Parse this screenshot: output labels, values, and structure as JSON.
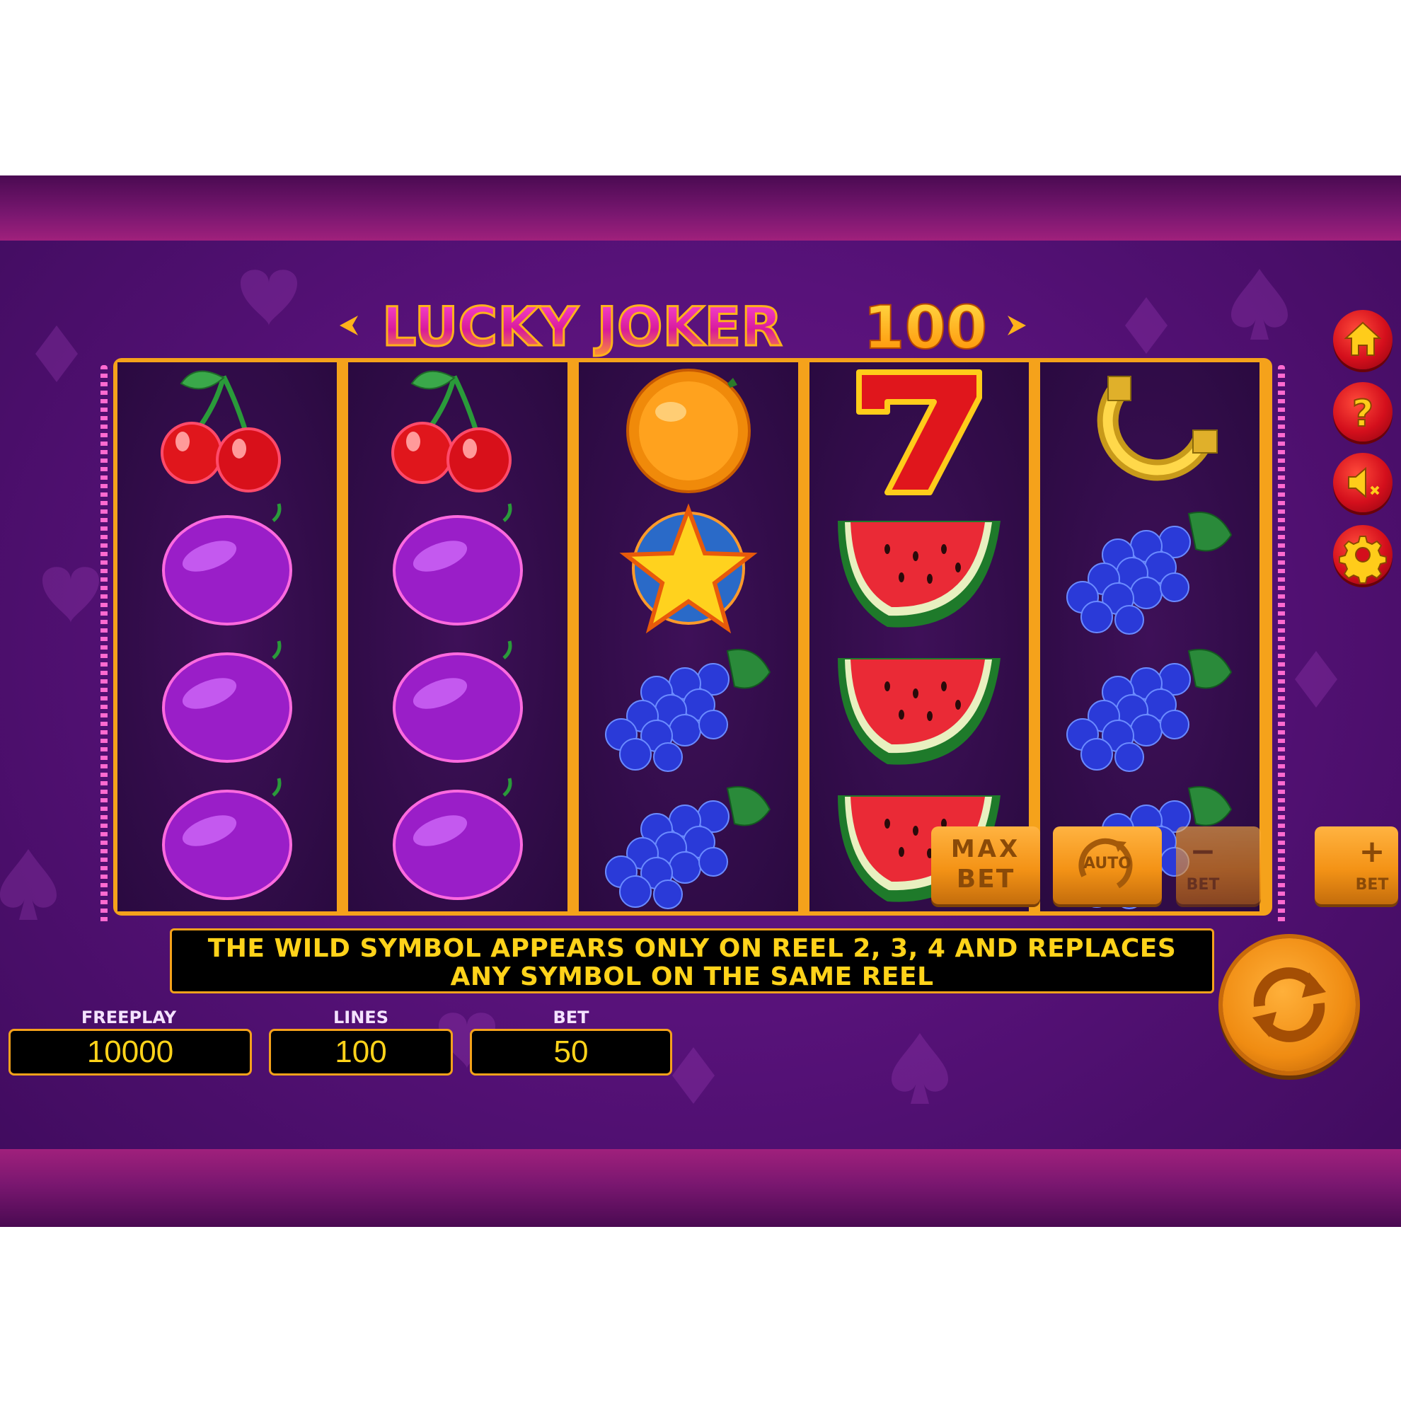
{
  "game": {
    "title_part1": "LUCKY JOKER",
    "title_part2": "100"
  },
  "reels": [
    [
      "cherry",
      "plum",
      "plum",
      "plum"
    ],
    [
      "cherry",
      "plum",
      "plum",
      "plum"
    ],
    [
      "orange",
      "star",
      "grapes",
      "grapes"
    ],
    [
      "seven",
      "watermelon",
      "watermelon",
      "watermelon"
    ],
    [
      "horseshoe",
      "grapes",
      "grapes",
      "grapes"
    ]
  ],
  "info_message": {
    "line1": "THE WILD SYMBOL APPEARS ONLY ON REEL 2, 3, 4 AND REPLACES",
    "line2": "ANY SYMBOL ON THE SAME REEL"
  },
  "stats": {
    "freeplay_label": "FREEPLAY",
    "freeplay_value": "10000",
    "lines_label": "LINES",
    "lines_value": "100",
    "bet_label": "BET",
    "bet_value": "50"
  },
  "controls": {
    "max_label": "MAX",
    "max_bet_label": "BET",
    "auto_label": "AUTO",
    "bet_minus_symbol": "−",
    "bet_minus_label": "BET",
    "bet_plus_symbol": "+",
    "bet_plus_label": "BET"
  },
  "side_menu": [
    "home-icon",
    "help-icon",
    "mute-icon",
    "settings-icon"
  ],
  "colors": {
    "accent_orange": "#f5a21b",
    "text_yellow": "#ffd31a",
    "button_red": "#d40f1c"
  }
}
